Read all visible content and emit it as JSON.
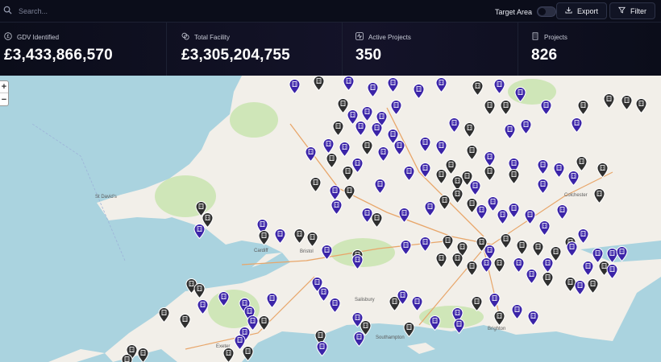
{
  "topbar": {
    "search_placeholder": "Search...",
    "target_area_label": "Target Area",
    "export_label": "Export",
    "filter_label": "Filter"
  },
  "stats": [
    {
      "label": "GDV Identified",
      "value": "£3,433,866,570",
      "icon": "currency-pound-icon"
    },
    {
      "label": "Total Facility",
      "value": "£3,305,204,755",
      "icon": "coins-icon"
    },
    {
      "label": "Active Projects",
      "value": "350",
      "icon": "activity-icon"
    },
    {
      "label": "Projects",
      "value": "826",
      "icon": "building-icon"
    }
  ],
  "map": {
    "zoom_in": "+",
    "zoom_out": "−",
    "colors": {
      "sea": "#aad3df",
      "land": "#f2efe9",
      "park": "#cfe6b8",
      "pin_active": "#3b24a8",
      "pin_inactive": "#2f2f2f"
    },
    "places": [
      "Cardiff",
      "Bristol",
      "Southampton",
      "Brighton",
      "Colchester",
      "Salisbury",
      "Exeter",
      "St David's"
    ]
  }
}
